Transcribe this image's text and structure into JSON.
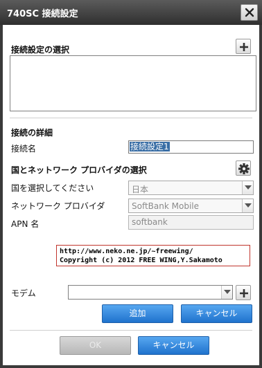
{
  "window": {
    "title": "740SC 接続設定"
  },
  "selection_section": {
    "heading": "接続設定の選択",
    "add_icon": "plus-icon",
    "list_items": []
  },
  "details_section": {
    "heading": "接続の詳細",
    "name_label": "接続名",
    "name_value": "接続設定1"
  },
  "provider_section": {
    "heading": "国とネットワーク プロバイダの選択",
    "settings_icon": "gear-icon",
    "country_label": "国を選択してください",
    "country_value": "日本",
    "provider_label": "ネットワーク プロバイダ",
    "provider_value": "SoftBank Mobile",
    "apn_label": "APN 名",
    "apn_value": "softbank"
  },
  "credits": {
    "line1": "http://www.neko.ne.jp/~freewing/",
    "line2": "Copyright (c) 2012 FREE WING,Y.Sakamoto"
  },
  "modem": {
    "label": "モデム",
    "value": "",
    "add_icon": "plus-icon",
    "add_button": "追加",
    "cancel_button": "キャンセル"
  },
  "footer": {
    "ok_button": "OK",
    "cancel_button": "キャンセル"
  },
  "colors": {
    "accent_blue": "#2a7fd6",
    "credit_border": "#c0342c",
    "title_bar": "#3a3a3a"
  }
}
